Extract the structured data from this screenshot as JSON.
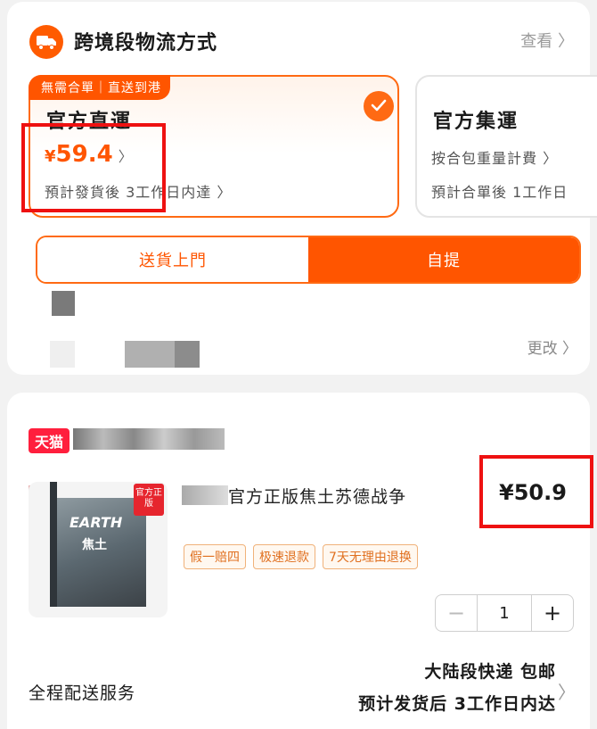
{
  "shipping_section": {
    "title": "跨境段物流方式",
    "view_label": "查看 〉"
  },
  "options": [
    {
      "tag": "無需合單｜直送到港",
      "name": "官方直運",
      "price_symbol": "¥",
      "price": "59.4",
      "price_chevron": "〉",
      "eta": "預計發貨後 3工作日内達 〉",
      "selected": true
    },
    {
      "name": "官方集運",
      "fee_line": "按合包重量計費 〉",
      "eta": "預計合單後 1工作日"
    }
  ],
  "delivery_toggle": {
    "options": [
      "送貨上門",
      "自提"
    ],
    "active": "自提"
  },
  "change_label": "更改 〉",
  "shop": {
    "logo_text": "天猫"
  },
  "product": {
    "title": "官方正版焦土苏德战争",
    "price": "¥50.9",
    "image_title": "EARTH",
    "image_subtitle": "焦土",
    "official_flag": "官方正版",
    "tags": [
      "假一赔四",
      "极速退款",
      "7天无理由退换"
    ],
    "quantity": "1",
    "minus": "−",
    "plus": "+"
  },
  "service": {
    "label": "全程配送服务",
    "line1": "大陆段快递 包邮",
    "line2": "预计发货后 3工作日内达",
    "chevron": "〉"
  },
  "colors": {
    "accent": "#ff5500",
    "highlight_box": "#ee1111",
    "tmall": "#ff1f3d"
  }
}
